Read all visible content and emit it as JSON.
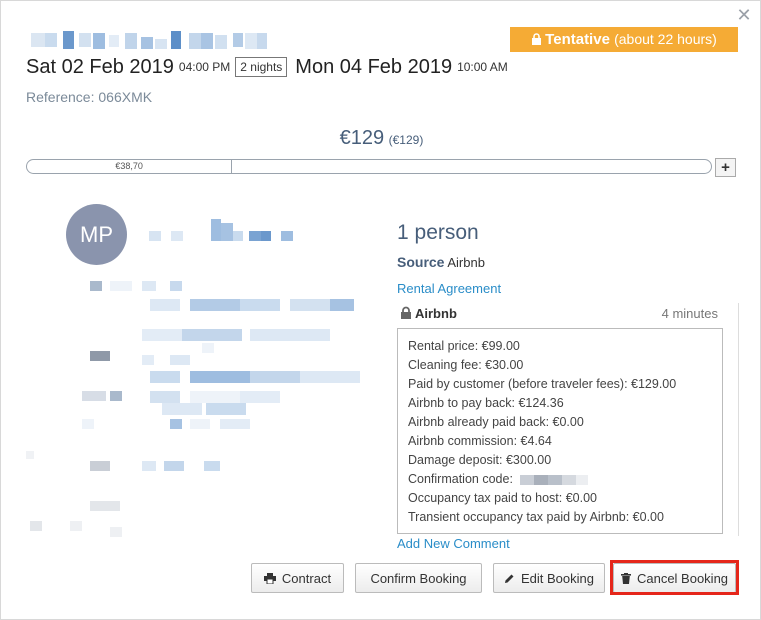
{
  "status_badge": {
    "label": "Tentative",
    "detail": "(about 22 hours)",
    "color": "#f5ab35"
  },
  "booking": {
    "checkin_date": "Sat 02 Feb 2019",
    "checkin_time": "04:00 PM",
    "nights": "2 nights",
    "checkout_date": "Mon 04 Feb 2019",
    "checkout_time": "10:00 AM",
    "reference": "Reference: 066XMK"
  },
  "price": {
    "amount": "€129",
    "detail": "(€129)"
  },
  "payment_bar": {
    "segment_label": "€38,70",
    "paid_fraction": 0.3
  },
  "guest": {
    "initials": "MP",
    "avatar_color": "#8a94ad"
  },
  "details": {
    "guests": "1 person",
    "source_label": "Source",
    "source_value": "Airbnb",
    "rental_agreement_link": "Rental Agreement"
  },
  "comment": {
    "author": "Airbnb",
    "time_ago": "4 minutes",
    "lines": [
      "Rental price: €99.00",
      "Cleaning fee: €30.00",
      "Paid by customer (before traveler fees): €129.00",
      "Airbnb to pay back: €124.36",
      "Airbnb already paid back: €0.00",
      "Airbnb commission: €4.64",
      "Damage deposit: €300.00",
      "Confirmation code:",
      "Occupancy tax paid to host: €0.00",
      "Transient occupancy tax paid by Airbnb: €0.00"
    ]
  },
  "add_comment_link": "Add New Comment",
  "buttons": {
    "contract": "Contract",
    "confirm": "Confirm Booking",
    "edit": "Edit Booking",
    "cancel": "Cancel Booking"
  },
  "icons": {
    "close": "close-icon",
    "lock": "lock-icon",
    "print": "print-icon",
    "edit": "pencil-icon",
    "cancel": "trash-icon",
    "plus": "plus-icon"
  }
}
